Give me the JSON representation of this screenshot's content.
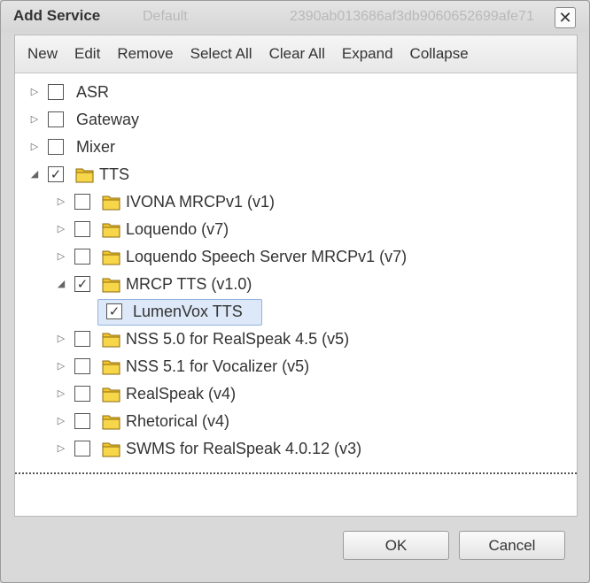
{
  "dialog": {
    "title": "Add Service",
    "ghost_text_1": "Default",
    "ghost_text_2": "2390ab013686af3db9060652699afe71",
    "close_symbol": "✕"
  },
  "toolbar": {
    "buttons": [
      "New",
      "Edit",
      "Remove",
      "Select All",
      "Clear All",
      "Expand",
      "Collapse"
    ]
  },
  "tree": [
    {
      "level": 0,
      "label": "ASR",
      "expander": "collapsed",
      "checked": false,
      "folder": false
    },
    {
      "level": 0,
      "label": "Gateway",
      "expander": "collapsed",
      "checked": false,
      "folder": false
    },
    {
      "level": 0,
      "label": "Mixer",
      "expander": "collapsed",
      "checked": false,
      "folder": false
    },
    {
      "level": 0,
      "label": "TTS",
      "expander": "expanded",
      "checked": true,
      "folder": true
    },
    {
      "level": 1,
      "label": "IVONA MRCPv1 (v1)",
      "expander": "collapsed",
      "checked": false,
      "folder": true
    },
    {
      "level": 1,
      "label": "Loquendo (v7)",
      "expander": "collapsed",
      "checked": false,
      "folder": true
    },
    {
      "level": 1,
      "label": "Loquendo Speech Server MRCPv1 (v7)",
      "expander": "collapsed",
      "checked": false,
      "folder": true
    },
    {
      "level": 1,
      "label": "MRCP TTS (v1.0)",
      "expander": "expanded",
      "checked": true,
      "folder": true
    },
    {
      "level": 2,
      "label": "LumenVox TTS",
      "expander": "none",
      "checked": true,
      "folder": false,
      "selected": true
    },
    {
      "level": 1,
      "label": "NSS 5.0 for RealSpeak 4.5 (v5)",
      "expander": "collapsed",
      "checked": false,
      "folder": true
    },
    {
      "level": 1,
      "label": "NSS 5.1 for Vocalizer (v5)",
      "expander": "collapsed",
      "checked": false,
      "folder": true
    },
    {
      "level": 1,
      "label": "RealSpeak (v4)",
      "expander": "collapsed",
      "checked": false,
      "folder": true
    },
    {
      "level": 1,
      "label": "Rhetorical (v4)",
      "expander": "collapsed",
      "checked": false,
      "folder": true
    },
    {
      "level": 1,
      "label": "SWMS for RealSpeak 4.0.12 (v3)",
      "expander": "collapsed",
      "checked": false,
      "folder": true
    }
  ],
  "icons": {
    "expander_collapsed": "▷",
    "expander_expanded": "◢",
    "check": "✓",
    "folder": "folder-icon"
  },
  "footer": {
    "ok_label": "OK",
    "cancel_label": "Cancel"
  }
}
